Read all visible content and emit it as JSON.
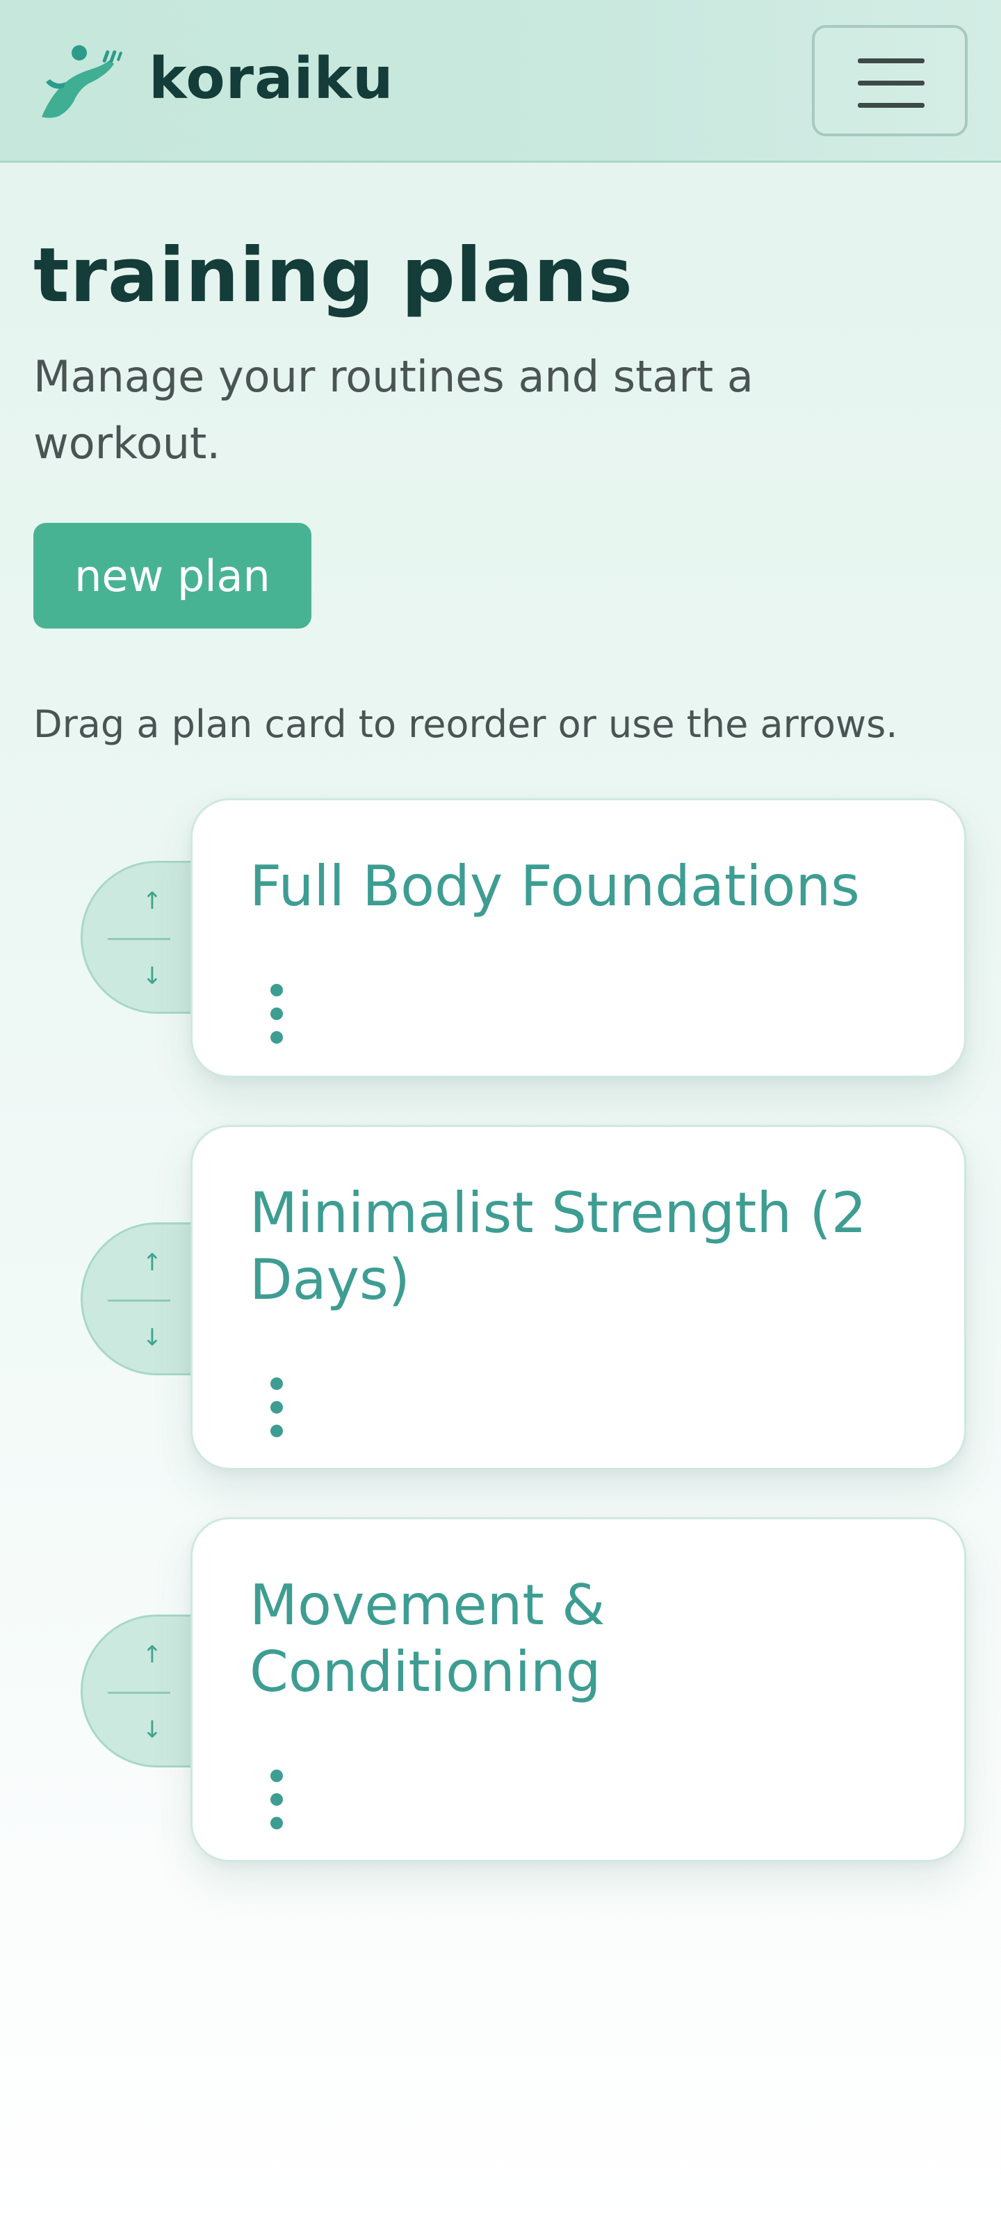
{
  "header": {
    "brand": "koraiku",
    "logo_icon": "runner-logo-icon",
    "menu_icon": "hamburger-menu-icon"
  },
  "page": {
    "title": "training plans",
    "subtitle": "Manage your routines and start a workout.",
    "new_plan_label": "new plan",
    "hint": "Drag a plan card to reorder or use the arrows."
  },
  "plans": [
    {
      "title": "Full Body Foundations",
      "menu_icon": "more-vertical-icon"
    },
    {
      "title": "Minimalist Strength (2 Days)",
      "menu_icon": "more-vertical-icon"
    },
    {
      "title": "Movement & Conditioning",
      "menu_icon": "more-vertical-icon"
    }
  ],
  "reorder": {
    "up_arrow": "↑",
    "down_arrow": "↓"
  },
  "colors": {
    "accent": "#48b393",
    "card_title": "#3e9d92",
    "brand_text": "#143c38",
    "header_bg": "#c6e7dc"
  }
}
